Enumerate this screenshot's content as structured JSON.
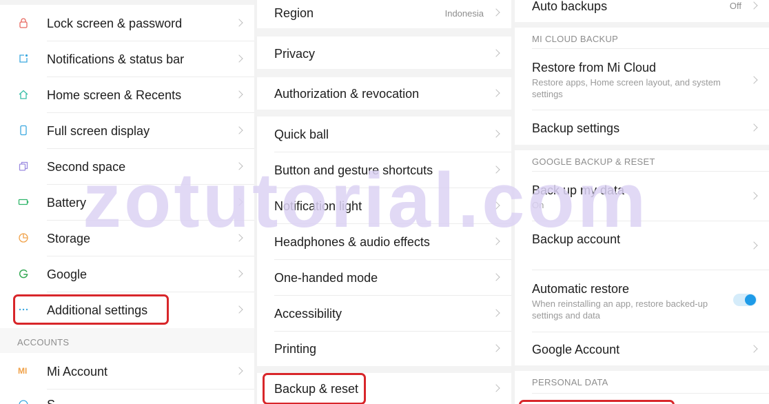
{
  "watermark": "zotutorial.com",
  "panel1": {
    "items": [
      {
        "label": "Lock screen & password",
        "icon": "lock-icon",
        "color": "#e8675f"
      },
      {
        "label": "Notifications & status bar",
        "icon": "notification-icon",
        "color": "#3aa7df"
      },
      {
        "label": "Home screen & Recents",
        "icon": "home-icon",
        "color": "#36bda6"
      },
      {
        "label": "Full screen display",
        "icon": "phone-icon",
        "color": "#3aa7df"
      },
      {
        "label": "Second space",
        "icon": "second-space-icon",
        "color": "#9b8ae0"
      },
      {
        "label": "Battery",
        "icon": "battery-icon",
        "color": "#2fb56a"
      },
      {
        "label": "Storage",
        "icon": "storage-icon",
        "color": "#f0a24a"
      },
      {
        "label": "Google",
        "icon": "google-icon",
        "color": "#32a852"
      },
      {
        "label": "Additional settings",
        "icon": "more-icon",
        "color": "#3aa7df"
      }
    ],
    "accounts_header": "ACCOUNTS",
    "mi_account_label": "Mi Account",
    "mi_icon_text": "MI",
    "partial_label": "S"
  },
  "panel2": {
    "region": {
      "label": "Region",
      "value": "Indonesia"
    },
    "privacy": "Privacy",
    "authorization": "Authorization & revocation",
    "items": [
      "Quick ball",
      "Button and gesture shortcuts",
      "Notification light",
      "Headphones & audio effects",
      "One-handed mode",
      "Accessibility",
      "Printing"
    ],
    "backup_reset": "Backup & reset"
  },
  "panel3": {
    "auto_backups": {
      "label": "Auto backups",
      "value": "Off"
    },
    "mi_cloud_header": "MI CLOUD BACKUP",
    "restore": {
      "label": "Restore from Mi Cloud",
      "sub": "Restore apps, Home screen layout, and system settings"
    },
    "backup_settings": "Backup settings",
    "google_header": "GOOGLE BACKUP & RESET",
    "back_up_data": {
      "label": "Back up my data",
      "sub": "On"
    },
    "backup_account": "Backup account",
    "automatic_restore": {
      "label": "Automatic restore",
      "sub": "When reinstalling an app, restore backed-up settings and data",
      "enabled": true
    },
    "google_account": "Google Account",
    "personal_header": "PERSONAL DATA"
  },
  "colors": {
    "highlight": "#d8262a",
    "accent": "#1e9be8"
  }
}
